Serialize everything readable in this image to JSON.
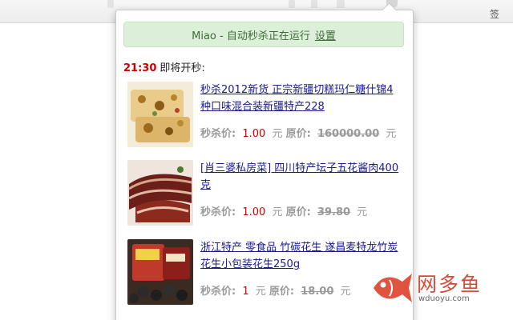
{
  "popup": {
    "status_text": "Miao - 自动秒杀正在运行",
    "settings_label": "设置",
    "countdown_time": "21:30",
    "countdown_label": "即将开秒:"
  },
  "products": [
    {
      "title": "秒杀2012新货 正宗新疆切糕玛仁糖什锦4种口味混合装新疆特产228",
      "sale_label": "秒杀价:",
      "sale_price": "1.00",
      "currency": "元",
      "orig_label": "原价:",
      "orig_price": "160000.00",
      "thumb_icon": "cake-photo"
    },
    {
      "title": "[肖三婆私房菜] 四川特产坛子五花酱肉400克",
      "sale_label": "秒杀价:",
      "sale_price": "1.00",
      "currency": "元",
      "orig_label": "原价:",
      "orig_price": "39.80",
      "thumb_icon": "cured-pork-photo"
    },
    {
      "title": "浙江特产 零食品 竹碳花生 遂昌麦特龙竹炭花生小包装花生250g",
      "sale_label": "秒杀价:",
      "sale_price": "1",
      "currency": "元",
      "orig_label": "原价:",
      "orig_price": "18.00",
      "thumb_icon": "peanut-package-photo"
    }
  ],
  "browser": {
    "edge_text": "签"
  },
  "watermark": {
    "cn": "网多鱼",
    "en": "wduoyu.com",
    "logo_icon": "fish-logo-icon"
  },
  "colors": {
    "status_bg": "#dcefd8",
    "status_text": "#3f6b3a",
    "sale_red": "#cc0000",
    "link_blue": "#1a1a8c",
    "watermark_red": "#d14c3a"
  }
}
